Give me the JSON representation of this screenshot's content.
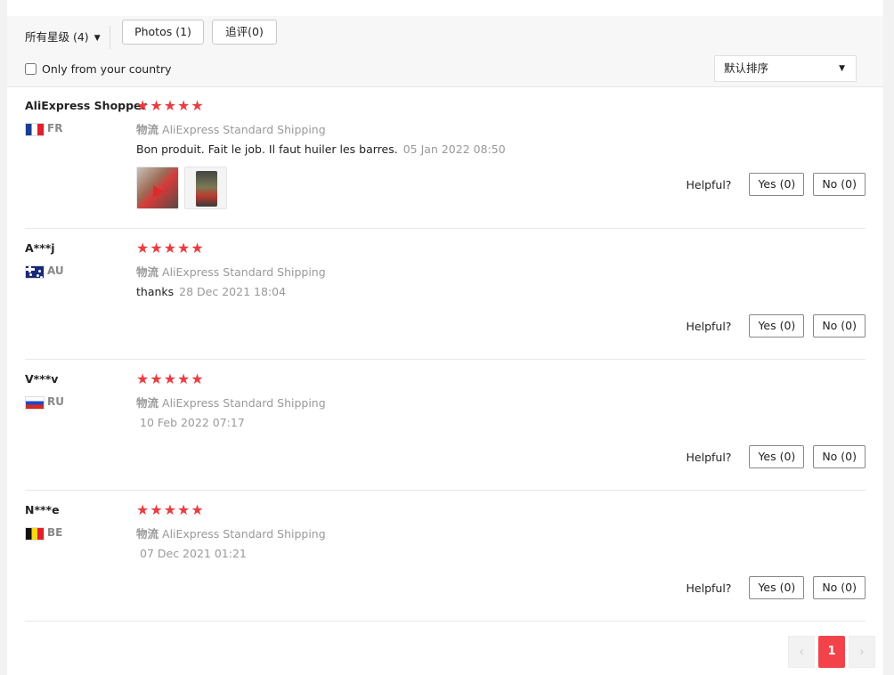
{
  "filters": {
    "star_filter_label": "所有星级 (4)",
    "photos_label": "Photos (1)",
    "followup_label": "追评(0)",
    "country_label": "Only from your country",
    "sort_label": "默认排序"
  },
  "icons": {
    "dropdown": "chevron-down-icon",
    "star": "star-icon",
    "prev": "chevron-left-icon",
    "next": "chevron-right-icon"
  },
  "colors": {
    "star": "#e93d41",
    "page_current": "#f2424a"
  },
  "shipping_label": "物流",
  "helpful_label": "Helpful?",
  "stars_text": "★★★★★",
  "reviews": [
    {
      "user": "AliExpress Shopper",
      "country": "FR",
      "rating": 5,
      "shipping": "AliExpress Standard Shipping",
      "text": "Bon produit. Fait le job. Il faut huiler les barres.",
      "date": "05 Jan 2022 08:50",
      "photos": 2,
      "yes": "Yes (0)",
      "no": "No (0)"
    },
    {
      "user": "A***j",
      "country": "AU",
      "rating": 5,
      "shipping": "AliExpress Standard Shipping",
      "text": "thanks",
      "date": "28 Dec 2021 18:04",
      "yes": "Yes (0)",
      "no": "No (0)"
    },
    {
      "user": "V***v",
      "country": "RU",
      "rating": 5,
      "shipping": "AliExpress Standard Shipping",
      "text": "",
      "date": "10 Feb 2022 07:17",
      "yes": "Yes (0)",
      "no": "No (0)"
    },
    {
      "user": "N***e",
      "country": "BE",
      "rating": 5,
      "shipping": "AliExpress Standard Shipping",
      "text": "",
      "date": "07 Dec 2021 01:21",
      "yes": "Yes (0)",
      "no": "No (0)"
    }
  ],
  "pagination": {
    "prev": "‹",
    "current": "1",
    "next": "›"
  }
}
